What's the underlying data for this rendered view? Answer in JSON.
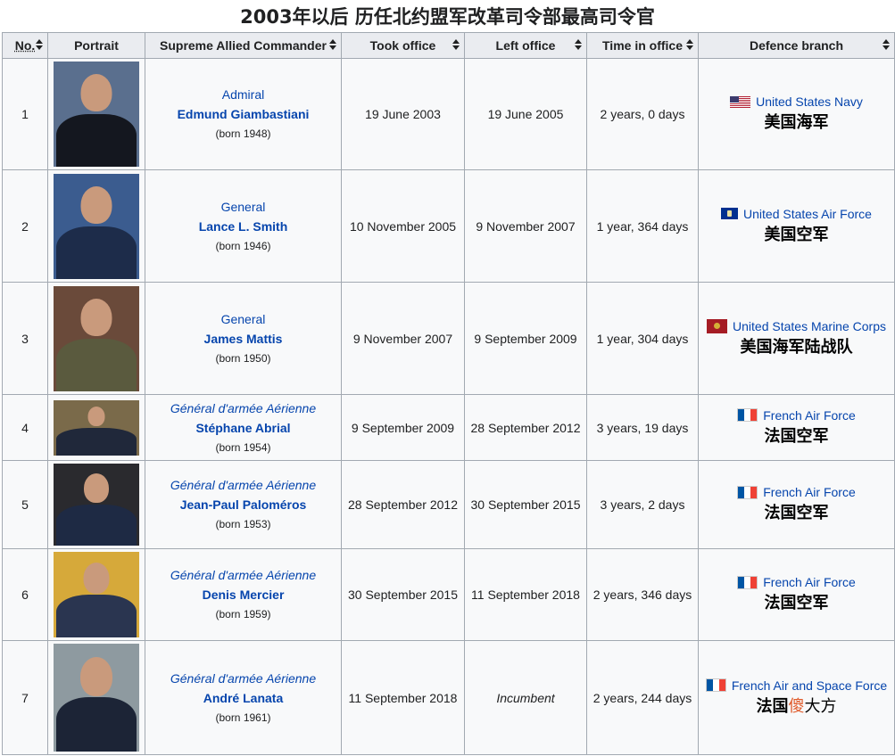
{
  "page_title": "2003年以后 历任北约盟军改革司令部最高司令官",
  "columns": [
    "No.",
    "Portrait",
    "Supreme Allied Commander",
    "Took office",
    "Left office",
    "Time in office",
    "Defence branch"
  ],
  "rows": [
    {
      "no": "1",
      "rank": "Admiral",
      "rank_italic": false,
      "name": "Edmund Giambastiani",
      "born": "(born 1948)",
      "took": "19 June 2003",
      "left": "19 June 2005",
      "left_italic": false,
      "time": "2 years, 0 days",
      "branch": "United States Navy",
      "flag": "us-flag-icon",
      "cn": "美国海军",
      "cn_red": "",
      "cn_tail": ""
    },
    {
      "no": "2",
      "rank": "General",
      "rank_italic": false,
      "name": "Lance L. Smith",
      "born": "(born 1946)",
      "took": "10 November 2005",
      "left": "9 November 2007",
      "left_italic": false,
      "time": "1 year, 364 days",
      "branch": "United States Air Force",
      "flag": "usaf-flag-icon",
      "cn": "美国空军",
      "cn_red": "",
      "cn_tail": ""
    },
    {
      "no": "3",
      "rank": "General",
      "rank_italic": false,
      "name": "James Mattis",
      "born": "(born 1950)",
      "took": "9 November 2007",
      "left": "9 September 2009",
      "left_italic": false,
      "time": "1 year, 304 days",
      "branch": "United States Marine Corps",
      "flag": "usmc-flag-icon",
      "cn": "美国海军陆战队",
      "cn_red": "",
      "cn_tail": ""
    },
    {
      "no": "4",
      "rank": "Général d'armée Aérienne",
      "rank_italic": true,
      "name": "Stéphane Abrial",
      "born": "(born 1954)",
      "took": "9 September 2009",
      "left": "28 September 2012",
      "left_italic": false,
      "time": "3 years, 19 days",
      "branch": "French Air Force",
      "flag": "france-flag-icon",
      "cn": "法国空军",
      "cn_red": "",
      "cn_tail": ""
    },
    {
      "no": "5",
      "rank": "Général d'armée Aérienne",
      "rank_italic": true,
      "name": "Jean-Paul Paloméros",
      "born": "(born 1953)",
      "took": "28 September 2012",
      "left": "30 September 2015",
      "left_italic": false,
      "time": "3 years, 2 days",
      "branch": "French Air Force",
      "flag": "france-flag-icon",
      "cn": "法国空军",
      "cn_red": "",
      "cn_tail": ""
    },
    {
      "no": "6",
      "rank": "Général d'armée Aérienne",
      "rank_italic": true,
      "name": "Denis Mercier",
      "born": "(born 1959)",
      "took": "30 September 2015",
      "left": "11 September 2018",
      "left_italic": false,
      "time": "2 years, 346 days",
      "branch": "French Air Force",
      "flag": "france-flag-icon",
      "cn": "法国空军",
      "cn_red": "",
      "cn_tail": ""
    },
    {
      "no": "7",
      "rank": "Général d'armée Aérienne",
      "rank_italic": true,
      "name": "André Lanata",
      "born": "(born 1961)",
      "took": "11 September 2018",
      "left": "Incumbent",
      "left_italic": true,
      "time": "2 years, 244 days",
      "branch": "French Air and Space Force",
      "flag": "france-flag-icon",
      "cn": "法国",
      "cn_red": "傻",
      "cn_tail": "大方"
    }
  ],
  "colors": {
    "link": "#0645ad",
    "header_bg": "#eaecf0",
    "cell_bg": "#f8f9fa",
    "border": "#a2a9b1",
    "highlight": "#e05a2a"
  }
}
